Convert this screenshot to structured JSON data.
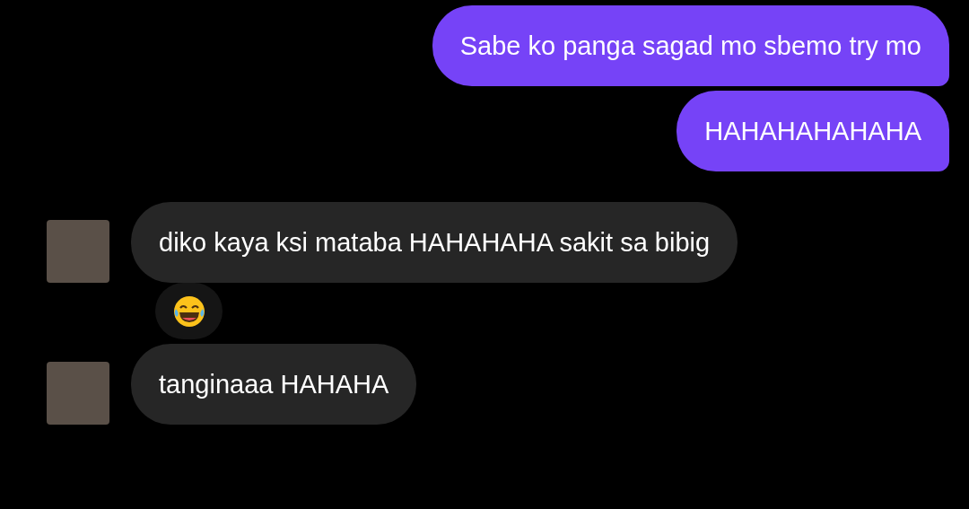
{
  "messages": [
    {
      "kind": "sent",
      "text": "Sabe ko panga sagad mo sbemo try mo",
      "reaction": false
    },
    {
      "kind": "sent",
      "text": "HAHAHAHAHAHA",
      "reaction": false
    },
    {
      "kind": "received",
      "text": "diko kaya ksi mataba HAHAHAHA sakit sa bibig",
      "reaction": true
    },
    {
      "kind": "received",
      "text": "tanginaaa HAHAHA",
      "reaction": false
    }
  ]
}
